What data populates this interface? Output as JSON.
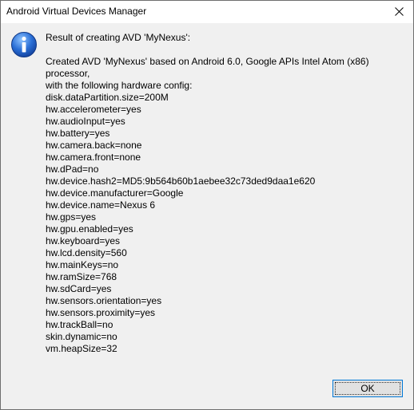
{
  "window": {
    "title": "Android Virtual Devices Manager"
  },
  "dialog": {
    "icon": "info-icon",
    "heading": "Result of creating AVD 'MyNexus':",
    "lines": [
      "Created AVD 'MyNexus' based on Android 6.0, Google APIs Intel Atom (x86)",
      "processor,",
      "with the following hardware config:",
      "disk.dataPartition.size=200M",
      "hw.accelerometer=yes",
      "hw.audioInput=yes",
      "hw.battery=yes",
      "hw.camera.back=none",
      "hw.camera.front=none",
      "hw.dPad=no",
      "hw.device.hash2=MD5:9b564b60b1aebee32c73ded9daa1e620",
      "hw.device.manufacturer=Google",
      "hw.device.name=Nexus 6",
      "hw.gps=yes",
      "hw.gpu.enabled=yes",
      "hw.keyboard=yes",
      "hw.lcd.density=560",
      "hw.mainKeys=no",
      "hw.ramSize=768",
      "hw.sdCard=yes",
      "hw.sensors.orientation=yes",
      "hw.sensors.proximity=yes",
      "hw.trackBall=no",
      "skin.dynamic=no",
      "vm.heapSize=32"
    ],
    "ok_label": "OK"
  },
  "colors": {
    "icon_blue": "#1f5fbf",
    "focus_border": "#0078d7"
  }
}
